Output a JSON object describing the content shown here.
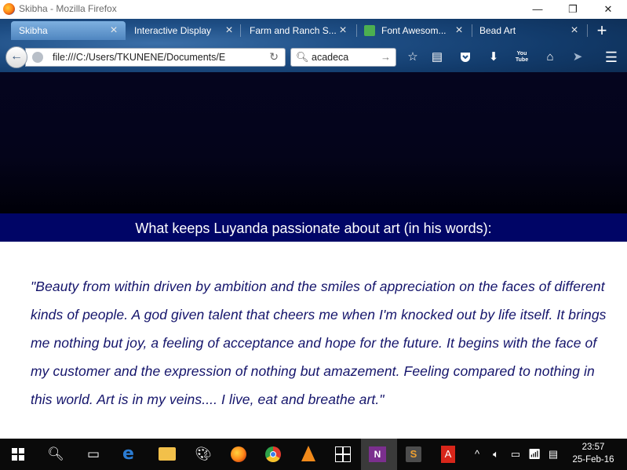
{
  "window": {
    "title": "Skibha - Mozilla Firefox",
    "minimize": "—",
    "maximize": "❐",
    "close": "✕"
  },
  "tabs": [
    {
      "label": "Skibha",
      "active": true
    },
    {
      "label": "Interactive Display",
      "active": false
    },
    {
      "label": "Farm and Ranch S...",
      "active": false
    },
    {
      "label": "Font Awesom...",
      "active": false
    },
    {
      "label": "Bead Art",
      "active": false
    }
  ],
  "new_tab": "+",
  "navbar": {
    "back": "←",
    "url": "file:///C:/Users/TKUNENE/Documents/E",
    "reload": "↻",
    "search_value": "acadeca",
    "search_go": "→",
    "tools": [
      "bookmark-star-icon",
      "reading-list-icon",
      "pocket-icon",
      "download-icon",
      "youtube-icon",
      "home-icon",
      "send-icon",
      "menu-icon"
    ],
    "youtube_label_1": "You",
    "youtube_label_2": "Tube"
  },
  "page": {
    "heading": "What keeps Luyanda passionate about art (in his words):",
    "quote": "\"Beauty from within driven by ambition and the smiles of appreciation on the faces of different kinds of people. A god given talent that cheers me when I'm knocked out by life itself. It brings me nothing but joy, a feeling of acceptance and hope for the future. It begins with the face of my customer and the expression of nothing but amazement. Feeling compared to nothing in this world. Art is in my veins.... I live, eat and breathe art.\""
  },
  "taskbar": {
    "pinned": [
      "windows-start",
      "search",
      "task-view",
      "edge",
      "file-explorer",
      "paint",
      "firefox",
      "chrome",
      "vlc",
      "store",
      "onenote",
      "sublime-text",
      "acrobat"
    ],
    "onenote_label": "N",
    "sublime_label": "S",
    "acrobat_label": "A",
    "tray_arrow": "^",
    "clock_time": "23:57",
    "clock_date": "25-Feb-16"
  },
  "colors": {
    "heading_band": "#000566",
    "quote_text": "#14146b",
    "hero": "#04041a"
  }
}
